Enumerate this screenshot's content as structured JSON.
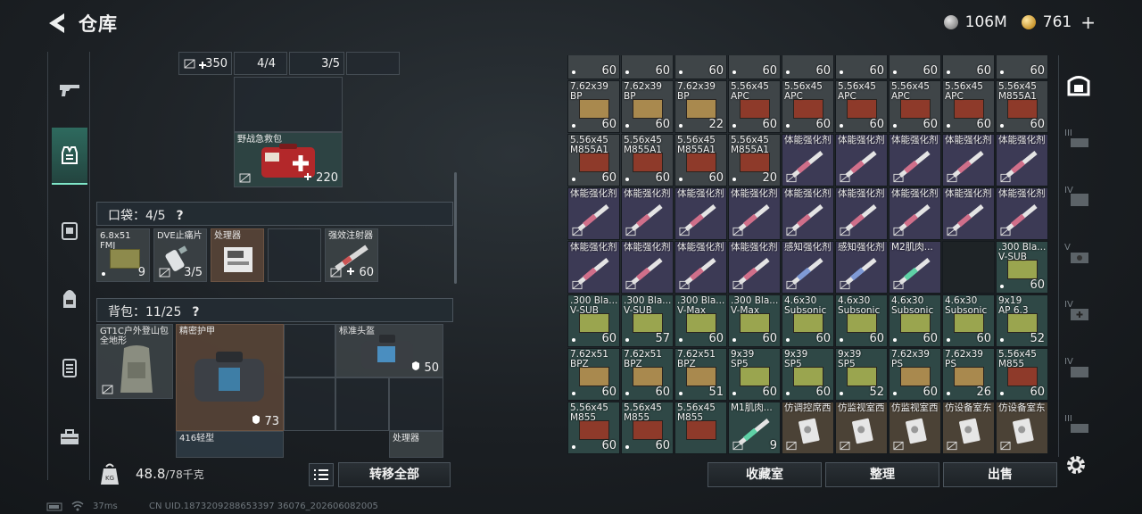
{
  "header": {
    "title": "仓库",
    "currency_silver": "106M",
    "currency_gold": "761",
    "plus_label": "+"
  },
  "left_sidebar": {
    "tabs": [
      {
        "icon": "gun-icon"
      },
      {
        "icon": "armor-vest-icon",
        "active": true
      },
      {
        "icon": "chest-rig-icon"
      },
      {
        "icon": "backpack-icon"
      },
      {
        "icon": "container-icon"
      },
      {
        "icon": "toolbox-icon"
      }
    ]
  },
  "stash_top": {
    "counts": [
      "350",
      "4/4",
      "3/5"
    ],
    "first_aid": {
      "name": "野战急救包",
      "count": "220"
    }
  },
  "pockets": {
    "label": "口袋：",
    "capacity": "4/5",
    "help": "?",
    "items": [
      {
        "name": "6.8x51\nFMJ",
        "count": "9"
      },
      {
        "name": "DVE止痛片",
        "count": "3/5"
      },
      {
        "name": "处理器",
        "count": ""
      },
      {
        "name": "",
        "count": ""
      },
      {
        "name": "强效注射器",
        "count": "60"
      }
    ]
  },
  "backpack": {
    "label": "背包：",
    "capacity": "11/25",
    "help": "?",
    "items": {
      "bag": {
        "name": "GT1C户外登山包\n全地形"
      },
      "armor": {
        "name": "精密护甲",
        "durability": "73"
      },
      "helmet": {
        "name": "标准头盔",
        "durability": "50"
      },
      "rifle": {
        "name": "416轻型"
      },
      "processor": {
        "name": "处理器"
      }
    }
  },
  "bottom_left": {
    "weight": "48.8",
    "weight_max": "/78千克",
    "transfer_all": "转移全部"
  },
  "grid": {
    "rows": [
      [
        {
          "name": "",
          "count": "60",
          "color": "gray"
        },
        {
          "name": "",
          "count": "60",
          "color": "gray"
        },
        {
          "name": "",
          "count": "60",
          "color": "gray"
        },
        {
          "name": "",
          "count": "60",
          "color": "gray"
        },
        {
          "name": "",
          "count": "60",
          "color": "gray"
        },
        {
          "name": "",
          "count": "60",
          "color": "gray"
        },
        {
          "name": "",
          "count": "60",
          "color": "gray"
        },
        {
          "name": "",
          "count": "60",
          "color": "gray"
        },
        {
          "name": "",
          "count": "60",
          "color": "gray"
        }
      ],
      [
        {
          "name": "7.62x39\nBP",
          "count": "60",
          "color": "gray"
        },
        {
          "name": "7.62x39\nBP",
          "count": "60",
          "color": "gray"
        },
        {
          "name": "7.62x39\nBP",
          "count": "22",
          "color": "gray"
        },
        {
          "name": "5.56x45\nAPC",
          "count": "60",
          "color": "gray"
        },
        {
          "name": "5.56x45\nAPC",
          "count": "60",
          "color": "gray"
        },
        {
          "name": "5.56x45\nAPC",
          "count": "60",
          "color": "gray"
        },
        {
          "name": "5.56x45\nAPC",
          "count": "60",
          "color": "gray"
        },
        {
          "name": "5.56x45\nAPC",
          "count": "60",
          "color": "gray"
        },
        {
          "name": "5.56x45\nM855A1",
          "count": "60",
          "color": "gray"
        }
      ],
      [
        {
          "name": "5.56x45\nM855A1",
          "count": "60",
          "color": "gray"
        },
        {
          "name": "5.56x45\nM855A1",
          "count": "60",
          "color": "gray"
        },
        {
          "name": "5.56x45\nM855A1",
          "count": "60",
          "color": "gray"
        },
        {
          "name": "5.56x45\nM855A1",
          "count": "20",
          "color": "gray"
        },
        {
          "name": "体能强化剂",
          "count": "",
          "color": "purple"
        },
        {
          "name": "体能强化剂",
          "count": "",
          "color": "purple"
        },
        {
          "name": "体能强化剂",
          "count": "",
          "color": "purple"
        },
        {
          "name": "体能强化剂",
          "count": "",
          "color": "purple"
        },
        {
          "name": "体能强化剂",
          "count": "",
          "color": "purple"
        }
      ],
      [
        {
          "name": "体能强化剂",
          "count": "",
          "color": "purple"
        },
        {
          "name": "体能强化剂",
          "count": "",
          "color": "purple"
        },
        {
          "name": "体能强化剂",
          "count": "",
          "color": "purple"
        },
        {
          "name": "体能强化剂",
          "count": "",
          "color": "purple"
        },
        {
          "name": "体能强化剂",
          "count": "",
          "color": "purple"
        },
        {
          "name": "体能强化剂",
          "count": "",
          "color": "purple"
        },
        {
          "name": "体能强化剂",
          "count": "",
          "color": "purple"
        },
        {
          "name": "体能强化剂",
          "count": "",
          "color": "purple"
        },
        {
          "name": "体能强化剂",
          "count": "",
          "color": "purple"
        }
      ],
      [
        {
          "name": "体能强化剂",
          "count": "",
          "color": "purple"
        },
        {
          "name": "体能强化剂",
          "count": "",
          "color": "purple"
        },
        {
          "name": "体能强化剂",
          "count": "",
          "color": "purple"
        },
        {
          "name": "体能强化剂",
          "count": "",
          "color": "purple"
        },
        {
          "name": "感知强化剂",
          "count": "",
          "color": "purple"
        },
        {
          "name": "感知强化剂",
          "count": "",
          "color": "purple"
        },
        {
          "name": "M2肌肉...",
          "count": "",
          "color": "purple"
        },
        {
          "name": "",
          "count": "",
          "color": "empty"
        },
        {
          "name": ".300 Bla...\nV-SUB",
          "count": "60",
          "color": "teal"
        }
      ],
      [
        {
          "name": ".300 Bla...\nV-SUB",
          "count": "60",
          "color": "teal"
        },
        {
          "name": ".300 Bla...\nV-SUB",
          "count": "57",
          "color": "teal"
        },
        {
          "name": ".300 Bla...\nV-Max",
          "count": "60",
          "color": "teal"
        },
        {
          "name": ".300 Bla...\nV-Max",
          "count": "60",
          "color": "teal"
        },
        {
          "name": "4.6x30\nSubsonic",
          "count": "60",
          "color": "teal"
        },
        {
          "name": "4.6x30\nSubsonic",
          "count": "60",
          "color": "teal"
        },
        {
          "name": "4.6x30\nSubsonic",
          "count": "60",
          "color": "teal"
        },
        {
          "name": "4.6x30\nSubsonic",
          "count": "60",
          "color": "teal"
        },
        {
          "name": "9x19\nAP 6.3",
          "count": "52",
          "color": "teal"
        }
      ],
      [
        {
          "name": "7.62x51\nBPZ",
          "count": "60",
          "color": "teal"
        },
        {
          "name": "7.62x51\nBPZ",
          "count": "60",
          "color": "teal"
        },
        {
          "name": "7.62x51\nBPZ",
          "count": "51",
          "color": "teal"
        },
        {
          "name": "9x39\nSP5",
          "count": "60",
          "color": "teal"
        },
        {
          "name": "9x39\nSP5",
          "count": "60",
          "color": "teal"
        },
        {
          "name": "9x39\nSP5",
          "count": "52",
          "color": "teal"
        },
        {
          "name": "7.62x39\nPS",
          "count": "60",
          "color": "teal"
        },
        {
          "name": "7.62x39\nPS",
          "count": "26",
          "color": "teal"
        },
        {
          "name": "5.56x45\nM855",
          "count": "60",
          "color": "teal"
        }
      ],
      [
        {
          "name": "5.56x45\nM855",
          "count": "60",
          "color": "teal"
        },
        {
          "name": "5.56x45\nM855",
          "count": "60",
          "color": "teal"
        },
        {
          "name": "5.56x45\nM855",
          "count": "",
          "color": "teal"
        },
        {
          "name": "M1肌肉...",
          "count": "9",
          "color": "teal"
        },
        {
          "name": "仿调控席西",
          "count": "",
          "color": "gold"
        },
        {
          "name": "仿监视室西",
          "count": "",
          "color": "gold"
        },
        {
          "name": "仿监视室西",
          "count": "",
          "color": "gold"
        },
        {
          "name": "仿设备室东",
          "count": "",
          "color": "gold"
        },
        {
          "name": "仿设备室东",
          "count": "",
          "color": "gold"
        }
      ]
    ]
  },
  "bottom_right": {
    "collection_room": "收藏室",
    "sort": "整理",
    "sell": "出售"
  },
  "right_sidebar": {
    "tabs": [
      {
        "icon": "safe-box-icon",
        "level": ""
      },
      {
        "icon": "rifle-case-icon",
        "level": "III"
      },
      {
        "icon": "weapon-rack-icon",
        "level": "IV"
      },
      {
        "icon": "tactical-case-icon",
        "level": "V"
      },
      {
        "icon": "medical-case-icon",
        "level": "IV"
      },
      {
        "icon": "ammo-case-icon",
        "level": "IV"
      },
      {
        "icon": "gun-case-icon",
        "level": "III"
      }
    ]
  },
  "status": {
    "ping": "37ms",
    "uid": "CN UID.1873209288653397 36076_202606082005"
  },
  "colors": {
    "accent": "#7fe6c8",
    "gray": "#3f4548",
    "purple": "#3c3a55",
    "teal": "#2f4846",
    "gold": "#4b4236"
  }
}
